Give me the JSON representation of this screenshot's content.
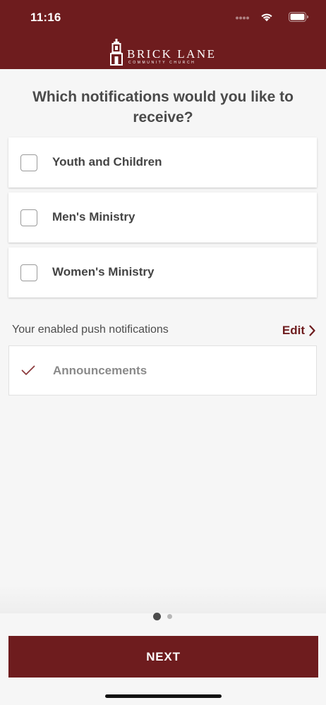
{
  "status_bar": {
    "time": "11:16"
  },
  "header": {
    "logo_title": "BRICK LANE",
    "logo_subtitle": "COMMUNITY CHURCH",
    "brand_color": "#6e1c1e"
  },
  "main": {
    "question": "Which notifications would you like to receive?",
    "options": [
      {
        "label": "Youth and Children",
        "checked": false
      },
      {
        "label": "Men's Ministry",
        "checked": false
      },
      {
        "label": "Women's Ministry",
        "checked": false
      }
    ],
    "enabled_section": {
      "heading": "Your enabled push notifications",
      "edit_label": "Edit",
      "items": [
        {
          "label": "Announcements",
          "enabled": true,
          "icon": "checkmark-icon"
        }
      ]
    }
  },
  "pagination": {
    "current_page": 1,
    "total_pages": 2
  },
  "footer": {
    "next_label": "NEXT"
  }
}
